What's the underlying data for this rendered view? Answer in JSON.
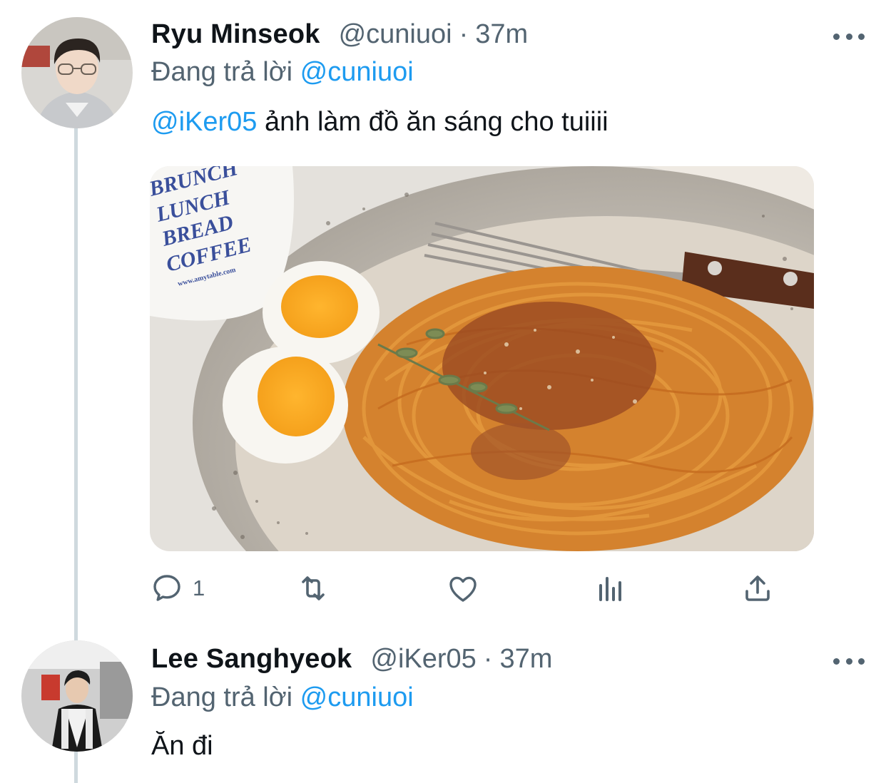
{
  "tweets": [
    {
      "author_name": "Ryu Minseok",
      "handle": "@cuniuoi",
      "separator": "·",
      "time": "37m",
      "reply_prefix": "Đang trả lời",
      "reply_to": "@cuniuoi",
      "mention": "@iKer05",
      "text": " ảnh làm đồ ăn sáng cho tuiiii",
      "media": {
        "mug_text": [
          "BRUNCH",
          "LUNCH",
          "BREAD",
          "COFFEE"
        ],
        "mug_url": "www.amytable.com"
      },
      "actions": {
        "reply_count": "1",
        "retweet_count": "",
        "like_count": ""
      }
    },
    {
      "author_name": "Lee Sanghyeok",
      "handle": "@iKer05",
      "separator": "·",
      "time": "37m",
      "reply_prefix": "Đang trả lời",
      "reply_to": "@cuniuoi",
      "text": "Ăn đi"
    }
  ],
  "icons": [
    "more-icon",
    "reply-icon",
    "retweet-icon",
    "like-icon",
    "analytics-icon",
    "share-icon"
  ],
  "colors": {
    "link": "#1d9bf0",
    "secondary": "#536471",
    "primary_text": "#0f1419",
    "thread_line": "#cfd9de"
  }
}
